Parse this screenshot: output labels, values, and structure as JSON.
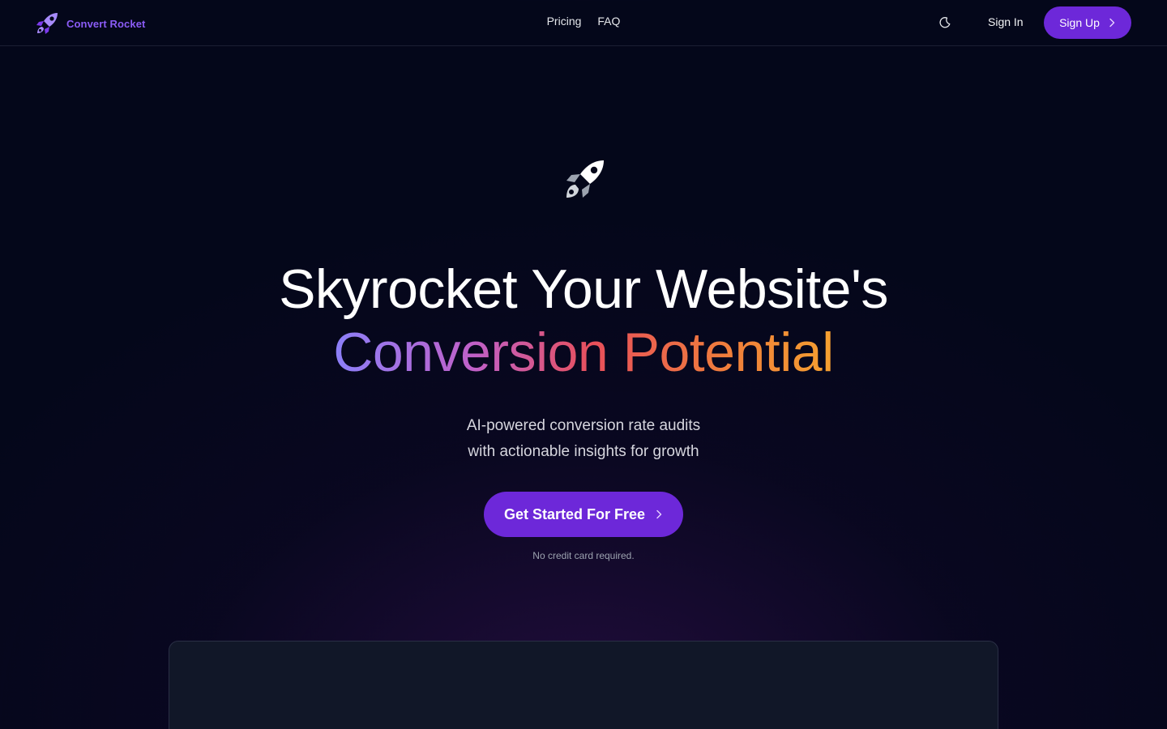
{
  "header": {
    "brand_name": "Convert Rocket",
    "nav": [
      {
        "label": "Pricing"
      },
      {
        "label": "FAQ"
      }
    ],
    "sign_in_label": "Sign In",
    "sign_up_label": "Sign Up",
    "icons": {
      "brand": "rocket-icon",
      "theme": "moon-icon",
      "chevron": "chevron-right-icon"
    }
  },
  "hero": {
    "headline_line1": "Skyrocket Your Website's",
    "headline_line2": "Conversion Potential",
    "subtitle_line1": "AI-powered conversion rate audits",
    "subtitle_line2": "with actionable insights for growth",
    "cta_label": "Get Started For Free",
    "note": "No credit card required.",
    "icon": "rocket-icon"
  },
  "colors": {
    "background": "#04071a",
    "accent": "#6d28d9",
    "brand_text": "#8b5cf6",
    "gradient_start": "#8b80f9",
    "gradient_end": "#f5a030"
  }
}
